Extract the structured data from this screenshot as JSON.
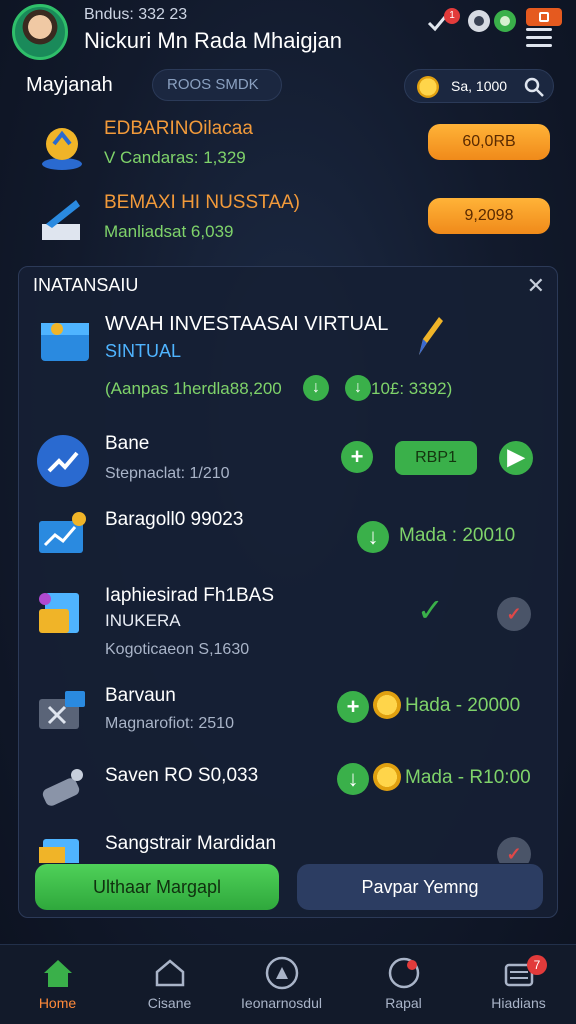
{
  "header": {
    "user_sub": "Bndus: 332 23",
    "user_name": "Nickuri Mn Rada Mhaigjan",
    "menu_label": ""
  },
  "search_row": {
    "brand": "Mayjanah",
    "search_placeholder": "ROOS SMDK",
    "balance": "Sa, 1000"
  },
  "promos": [
    {
      "title": "EDBARINOilacaa",
      "subtitle": "V Candaras: 1,329",
      "button": "60,0RB",
      "icon": "trophy-icon"
    },
    {
      "title": "BEMAXI HI NUSSTAA)",
      "subtitle": "Manliadsat 6,039",
      "button": "9,2098",
      "icon": "chart-book-icon"
    }
  ],
  "panel": {
    "title": "INATANSAIU",
    "featured": {
      "title": "WVAH INVESTAASAI VIRTUAL",
      "subtitle": "SINTUAL",
      "stat_left": "(Aanpas 1herdla88,200",
      "stat_right": "10£: 3392)"
    },
    "items": [
      {
        "name": "Bane",
        "desc": "Stepnaclat: 1/210",
        "action_label": "RBP1"
      },
      {
        "name": "Baragoll0 99023",
        "desc": "",
        "action_label": "Mada : 20010"
      },
      {
        "name": "Iaphiesirad Fh1BAS",
        "name2": "INUKERA",
        "desc": "Kogoticaeon S,1630"
      },
      {
        "name": "Barvaun",
        "desc": "Magnarofiot: 2510",
        "action_label": "Hada - 20000"
      },
      {
        "name": "Saven RO S0,033",
        "desc": "",
        "action_label": "Mada - R10:00"
      },
      {
        "name": "Sangstrair Mardidan",
        "desc": ""
      }
    ],
    "primary_button": "Ulthaar Margapl",
    "secondary_button": "Pavpar Yemng"
  },
  "bottom_nav": [
    {
      "label": "Home",
      "icon": "home-icon",
      "active": true
    },
    {
      "label": "Cisane",
      "icon": "house-outline-icon",
      "active": false
    },
    {
      "label": "Ieonarnosdul",
      "icon": "compass-icon",
      "active": false
    },
    {
      "label": "Rapal",
      "icon": "radar-icon",
      "active": false
    },
    {
      "label": "Hiadians",
      "icon": "list-icon",
      "active": false,
      "badge": "7"
    }
  ],
  "colors": {
    "accent_green": "#3ab04a",
    "accent_orange": "#f08a1a",
    "bg": "#121a2c"
  }
}
